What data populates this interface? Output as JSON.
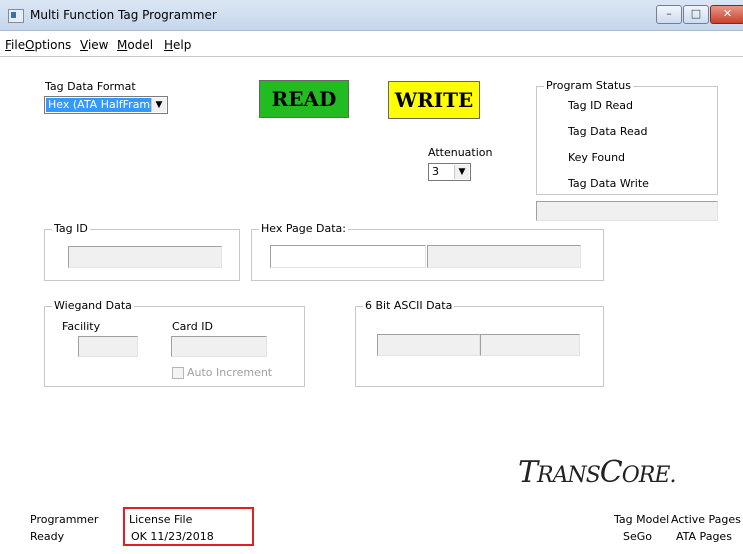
{
  "window": {
    "title": "Multi Function Tag Programmer",
    "minimize_glyph": "–",
    "maximize_glyph": "□",
    "close_glyph": "✕"
  },
  "menu": [
    {
      "first": "F",
      "rest": "ile"
    },
    {
      "first": "O",
      "rest": "ptions"
    },
    {
      "first": "V",
      "rest": "iew"
    },
    {
      "first": "M",
      "rest": "odel"
    },
    {
      "first": "H",
      "rest": "elp"
    }
  ],
  "tag_data_format": {
    "label": "Tag Data Format",
    "selected": "Hex (ATA HalfFrame)"
  },
  "buttons": {
    "read": "READ",
    "write": "WRITE",
    "read_color": "#22bb22",
    "write_color": "#ffff00"
  },
  "attenuation": {
    "label": "Attenuation",
    "selected": "3"
  },
  "program_status": {
    "title": "Program Status",
    "items": [
      "Tag ID Read",
      "Tag Data Read",
      "Key Found",
      "Tag Data Write"
    ],
    "status_value": ""
  },
  "tag_id": {
    "title": "Tag ID",
    "value": ""
  },
  "hex_page_data": {
    "title": "Hex Page Data:",
    "value1": "",
    "value2": ""
  },
  "wiegand": {
    "title": "Wiegand Data",
    "facility_label": "Facility",
    "card_id_label": "Card ID",
    "facility_value": "",
    "card_id_value": "",
    "auto_increment_label": "Auto Increment",
    "auto_increment_checked": false
  },
  "ascii_data": {
    "title": "6 Bit ASCII Data",
    "value1": "",
    "value2": ""
  },
  "logo": {
    "part1": "T",
    "part2": "RANS",
    "part3": "C",
    "part4": "ORE",
    "part5": "."
  },
  "status_bar": {
    "programmer_label": "Programmer",
    "programmer_value": "Ready",
    "license_label": "License File",
    "license_value": "OK 11/23/2018",
    "tag_model_label": "Tag Model",
    "tag_model_value": "SeGo",
    "active_pages_label": "Active Pages",
    "active_pages_value": "ATA Pages"
  }
}
